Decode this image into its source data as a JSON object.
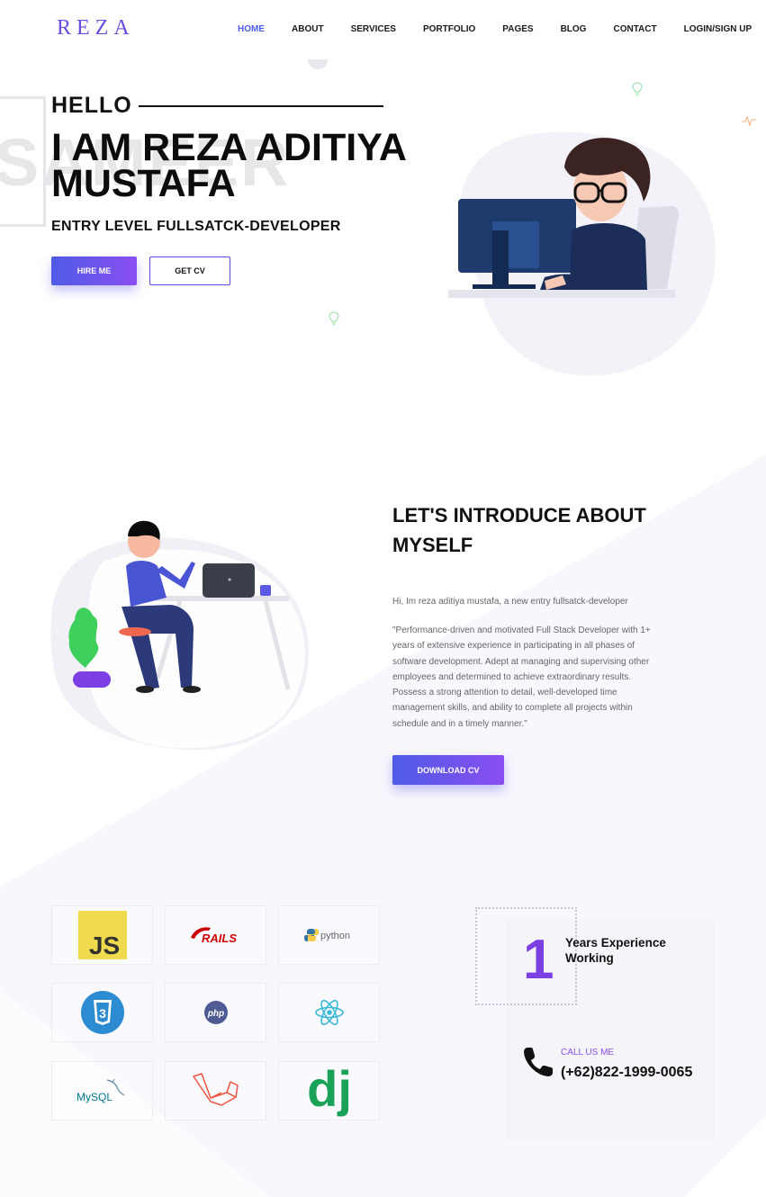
{
  "header": {
    "logo": "REZA",
    "nav": [
      {
        "label": "HOME"
      },
      {
        "label": "ABOUT"
      },
      {
        "label": "SERVICES"
      },
      {
        "label": "PORTFOLIO"
      },
      {
        "label": "PAGES"
      },
      {
        "label": "BLOG"
      },
      {
        "label": "CONTACT"
      },
      {
        "label": "LOGIN/SIGN UP"
      }
    ]
  },
  "hero": {
    "watermark": "SAMEER",
    "greeting": "HELLO",
    "name": "I AM REZA ADITIYA MUSTAFA",
    "role": "ENTRY LEVEL FULLSATCK-DEVELOPER",
    "hire_label": "HIRE ME",
    "cv_label": "GET CV"
  },
  "about": {
    "title": "LET'S INTRODUCE ABOUT MYSELF",
    "intro": "Hi, Im reza aditiya mustafa, a new entry fullsatck-developer",
    "body": "\"Performance-driven and motivated Full Stack Developer with 1+ years of extensive experience in participating in all phases of software development. Adept at managing and supervising other employees and determined to achieve extraordinary results. Possess a strong attention to detail, well-developed time management skills, and ability to complete all projects within schedule and in a timely manner.\"",
    "download_label": "DOWNLOAD CV"
  },
  "skills": {
    "items": [
      {
        "name": "js",
        "label": "JS"
      },
      {
        "name": "rails",
        "label": "RAILS"
      },
      {
        "name": "python",
        "label": "python"
      },
      {
        "name": "css3",
        "label": "3"
      },
      {
        "name": "php",
        "label": "php"
      },
      {
        "name": "react",
        "label": ""
      },
      {
        "name": "mysql",
        "label": "MySQL"
      },
      {
        "name": "laravel",
        "label": ""
      },
      {
        "name": "django",
        "label": "dj"
      }
    ]
  },
  "experience": {
    "years": "1",
    "label": "Years Experience Working",
    "call_label": "CALL US ME",
    "phone": "(+62)822-1999-0065"
  },
  "colors": {
    "accent": "#4c5de8",
    "purple": "#7b3fe4",
    "gradient_start": "#4e5be6",
    "gradient_end": "#8a4ff0",
    "band": "#f7f6fc"
  }
}
